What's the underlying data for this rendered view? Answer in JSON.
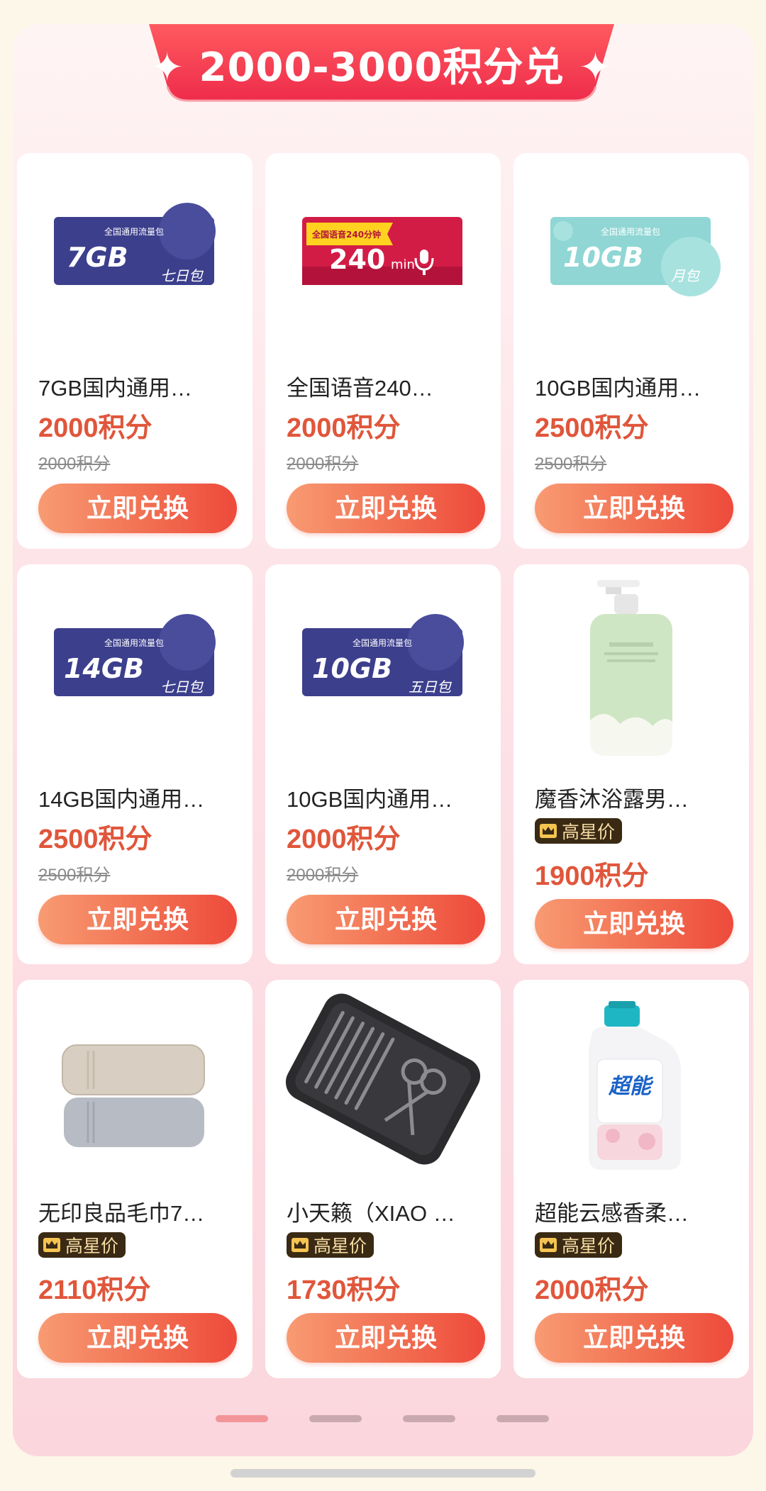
{
  "section": {
    "title": "✦ 2000-3000积分兑 ✦"
  },
  "products": [
    {
      "name": "7GB国内通用…",
      "price": "2000积分",
      "original_price": "2000积分",
      "button": "立即兑换",
      "card_image": {
        "badge": "全国通用流量包",
        "big": "7GB",
        "sub": "七日包",
        "theme": "navy"
      }
    },
    {
      "name": "全国语音240…",
      "price": "2000积分",
      "original_price": "2000积分",
      "button": "立即兑换",
      "card_image": {
        "badge": "全国语音240分钟",
        "big": "240",
        "unit": "min",
        "theme": "red"
      }
    },
    {
      "name": "10GB国内通用…",
      "price": "2500积分",
      "original_price": "2500积分",
      "button": "立即兑换",
      "card_image": {
        "badge": "全国通用流量包",
        "big": "10GB",
        "sub": "月包",
        "theme": "teal"
      }
    },
    {
      "name": "14GB国内通用…",
      "price": "2500积分",
      "original_price": "2500积分",
      "button": "立即兑换",
      "card_image": {
        "badge": "全国通用流量包",
        "big": "14GB",
        "sub": "七日包",
        "theme": "navy"
      }
    },
    {
      "name": "10GB国内通用…",
      "price": "2000积分",
      "original_price": "2000积分",
      "button": "立即兑换",
      "card_image": {
        "badge": "全国通用流量包",
        "big": "10GB",
        "sub": "五日包",
        "theme": "navy"
      }
    },
    {
      "name": "魔香沐浴露男…",
      "badge": "高星价",
      "price": "1900积分",
      "button": "立即兑换",
      "image": "shower-gel-bottle"
    },
    {
      "name": "无印良品毛巾7…",
      "badge": "高星价",
      "price": "2110积分",
      "button": "立即兑换",
      "image": "folded-towels"
    },
    {
      "name": "小天籁（XIAO …",
      "badge": "高星价",
      "price": "1730积分",
      "button": "立即兑换",
      "image": "nail-clipper-set"
    },
    {
      "name": "超能云感香柔…",
      "badge": "高星价",
      "price": "2000积分",
      "button": "立即兑换",
      "image": "laundry-detergent-bottle",
      "label_text": "超能"
    }
  ],
  "pagination": {
    "pages": 4,
    "active": 1
  },
  "colors": {
    "accent": "#e0563b",
    "banner": "#f13f55",
    "button_start": "#f89b72",
    "button_end": "#ee4a3b"
  }
}
